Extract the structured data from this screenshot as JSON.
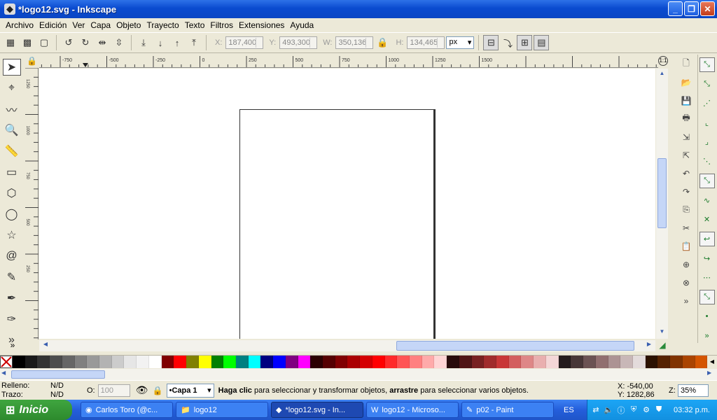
{
  "window": {
    "title": "*logo12.svg - Inkscape",
    "app_icon": "inkscape-icon"
  },
  "menubar": [
    "Archivo",
    "Edición",
    "Ver",
    "Capa",
    "Objeto",
    "Trayecto",
    "Texto",
    "Filtros",
    "Extensiones",
    "Ayuda"
  ],
  "toolbar": {
    "x_label": "X:",
    "x_value": "187,400",
    "y_label": "Y:",
    "y_value": "493,300",
    "w_label": "W:",
    "w_value": "350,136",
    "h_label": "H:",
    "h_value": "134,465",
    "unit": "px"
  },
  "ruler": {
    "h_ticks": [
      "-750",
      "-500",
      "-250",
      "0",
      "250",
      "500",
      "750",
      "1000",
      "1250",
      "1500"
    ],
    "v_ticks": [
      "1250",
      "1000",
      "750",
      "500",
      "250"
    ],
    "zoom_corner": "1:1"
  },
  "palette": [
    "#000000",
    "#1a1a1a",
    "#333333",
    "#4d4d4d",
    "#666666",
    "#808080",
    "#999999",
    "#b3b3b3",
    "#cccccc",
    "#e6e6e6",
    "#f2f2f2",
    "#ffffff",
    "#800000",
    "#ff0000",
    "#808000",
    "#ffff00",
    "#008000",
    "#00ff00",
    "#008080",
    "#00ffff",
    "#000080",
    "#0000ff",
    "#800080",
    "#ff00ff",
    "#2b0000",
    "#550000",
    "#800000",
    "#aa0000",
    "#d40000",
    "#ff0000",
    "#ff2a2a",
    "#ff5555",
    "#ff8080",
    "#ffaaaa",
    "#ffd5d5",
    "#280b0b",
    "#501616",
    "#782121",
    "#a02c2c",
    "#c83737",
    "#d35f5f",
    "#de8787",
    "#e9afaf",
    "#f4d7d7",
    "#241c1c",
    "#483737",
    "#6c5353",
    "#916f6f",
    "#ac9393",
    "#c8b7b7",
    "#e3dbdb",
    "#2b1100",
    "#552200",
    "#803300",
    "#aa4400",
    "#d45500"
  ],
  "status": {
    "fill_label": "Relleno:",
    "fill_value": "N/D",
    "stroke_label": "Trazo:",
    "stroke_value": "N/D",
    "opacity_label": "O:",
    "opacity_value": "100",
    "layer": "•Capa 1",
    "msg_bold1": "Haga clic",
    "msg_text1": " para seleccionar y transformar objetos, ",
    "msg_bold2": "arrastre",
    "msg_text2": " para seleccionar varios objetos.",
    "cursor_x": "X: -540,00",
    "cursor_y": "Y: 1282,86",
    "zoom_label": "Z:",
    "zoom_value": "35%"
  },
  "taskbar": {
    "start": "Inicio",
    "tasks": [
      {
        "label": "Carlos Toro (@c...",
        "icon": "firefox-icon"
      },
      {
        "label": "logo12",
        "icon": "folder-icon"
      },
      {
        "label": "*logo12.svg - In...",
        "icon": "inkscape-icon"
      },
      {
        "label": "logo12 - Microso...",
        "icon": "word-icon"
      },
      {
        "label": "p02 - Paint",
        "icon": "paint-icon"
      }
    ],
    "lang": "ES",
    "clock": "03:32 p.m."
  }
}
